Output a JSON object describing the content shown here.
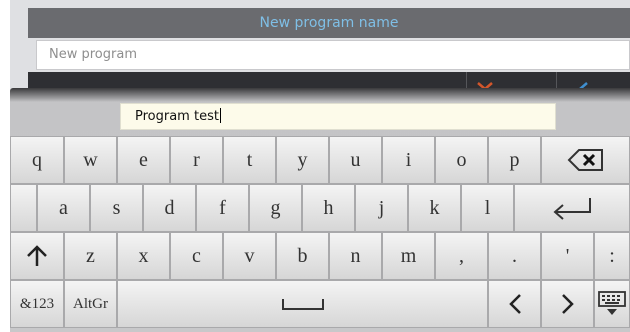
{
  "dialog": {
    "title": "New program name",
    "name_placeholder": "New program"
  },
  "keyboard": {
    "input_value": "Program test",
    "row1": [
      "q",
      "w",
      "e",
      "r",
      "t",
      "y",
      "u",
      "i",
      "o",
      "p"
    ],
    "row2": [
      "a",
      "s",
      "d",
      "f",
      "g",
      "h",
      "j",
      "k",
      "l"
    ],
    "row3": [
      "z",
      "x",
      "c",
      "v",
      "b",
      "n",
      "m",
      ",",
      ".",
      "'",
      ":"
    ],
    "row4": {
      "numbers_label": "&123",
      "altgr_label": "AltGr"
    },
    "icons": {
      "backspace": "backspace-icon",
      "enter": "enter-icon",
      "shift": "shift-up-arrow-icon",
      "space": "space-bar-icon",
      "left": "chevron-left-icon",
      "right": "chevron-right-icon",
      "hide": "keyboard-hide-icon"
    }
  },
  "colors": {
    "dialog_title": "#7fbfe6",
    "cancel_icon": "#d3562b",
    "ok_icon": "#3f8fd0",
    "input_bg": "#fdfbea"
  }
}
